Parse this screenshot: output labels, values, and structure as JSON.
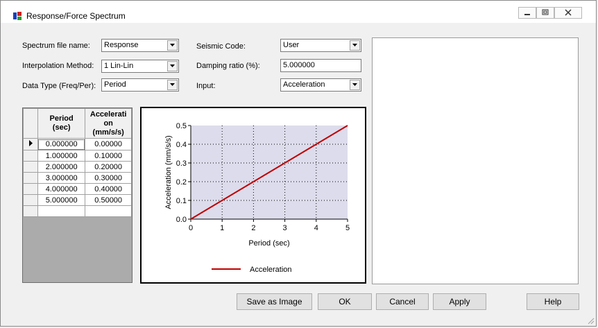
{
  "window": {
    "title": "Response/Force Spectrum"
  },
  "form": {
    "spectrum_file_label": "Spectrum file name:",
    "spectrum_file_value": "Response",
    "interp_label": "Interpolation Method:",
    "interp_value": "1 Lin-Lin",
    "datatype_label": "Data Type (Freq/Per):",
    "datatype_value": "Period",
    "seismic_label": "Seismic Code:",
    "seismic_value": "User",
    "damping_label": "Damping ratio (%):",
    "damping_value": "5.000000",
    "input_label": "Input:",
    "input_value": "Acceleration"
  },
  "table": {
    "col1_header_1": "Period",
    "col1_header_2": "(sec)",
    "col2_header_1": "Accelerati",
    "col2_header_2": "on",
    "col2_header_3": "(mm/s/s)",
    "rows": [
      {
        "period": "0.000000",
        "accel": "0.00000"
      },
      {
        "period": "1.000000",
        "accel": "0.10000"
      },
      {
        "period": "2.000000",
        "accel": "0.20000"
      },
      {
        "period": "3.000000",
        "accel": "0.30000"
      },
      {
        "period": "4.000000",
        "accel": "0.40000"
      },
      {
        "period": "5.000000",
        "accel": "0.50000"
      }
    ]
  },
  "chart_data": {
    "type": "line",
    "xlabel": "Period (sec)",
    "ylabel": "Acceleration (mm/s/s)",
    "xlim": [
      0,
      5
    ],
    "ylim": [
      0,
      0.5
    ],
    "xticks": [
      0,
      1,
      2,
      3,
      4,
      5
    ],
    "yticks": [
      0.0,
      0.1,
      0.2,
      0.3,
      0.4,
      0.5
    ],
    "ytick_labels": [
      "0.0",
      "0.1",
      "0.2",
      "0.3",
      "0.4",
      "0.5"
    ],
    "grid": true,
    "legend": "bottom",
    "series": [
      {
        "name": "Acceleration",
        "color": "#c00000",
        "x": [
          0,
          1,
          2,
          3,
          4,
          5
        ],
        "y": [
          0.0,
          0.1,
          0.2,
          0.3,
          0.4,
          0.5
        ]
      }
    ],
    "plot_bg": "#dcdcec"
  },
  "buttons": {
    "save_image": "Save as Image",
    "ok": "OK",
    "cancel": "Cancel",
    "apply": "Apply",
    "help": "Help"
  }
}
